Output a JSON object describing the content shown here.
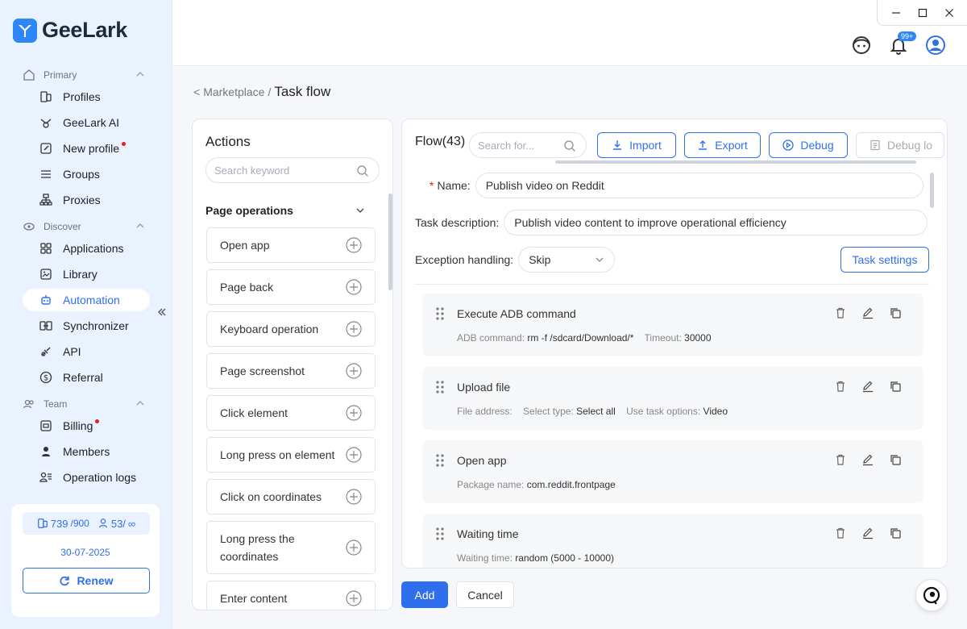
{
  "app": {
    "brand": "GeeLark",
    "accent": "#2f6fed"
  },
  "sidebar": {
    "sections": [
      {
        "label": "Primary",
        "items": [
          {
            "label": "Profiles",
            "icon": "profiles-icon"
          },
          {
            "label": "GeeLark AI",
            "icon": "ai-icon"
          },
          {
            "label": "New profile",
            "icon": "new-profile-icon",
            "dot": true
          },
          {
            "label": "Groups",
            "icon": "groups-icon"
          },
          {
            "label": "Proxies",
            "icon": "proxies-icon"
          }
        ]
      },
      {
        "label": "Discover",
        "items": [
          {
            "label": "Applications",
            "icon": "applications-icon"
          },
          {
            "label": "Library",
            "icon": "library-icon"
          },
          {
            "label": "Automation",
            "icon": "automation-icon",
            "active": true
          },
          {
            "label": "Synchronizer",
            "icon": "synchronizer-icon"
          },
          {
            "label": "API",
            "icon": "api-icon"
          },
          {
            "label": "Referral",
            "icon": "referral-icon"
          }
        ]
      },
      {
        "label": "Team",
        "items": [
          {
            "label": "Billing",
            "icon": "billing-icon",
            "dot": true
          },
          {
            "label": "Members",
            "icon": "members-icon"
          },
          {
            "label": "Operation logs",
            "icon": "operation-logs-icon"
          }
        ]
      }
    ],
    "quota": {
      "profiles_used": "739",
      "profiles_total": "/900",
      "members_used": "53/",
      "members_total": "∞",
      "date": "30-07-2025",
      "renew_label": "Renew"
    }
  },
  "topbar": {
    "notification_badge": "99+"
  },
  "breadcrumb": {
    "parent": "Marketplace",
    "separator": "/",
    "current": "Task flow",
    "back": "<"
  },
  "actions": {
    "title": "Actions",
    "search_placeholder": "Search keyword",
    "group_title": "Page operations",
    "items": [
      "Open app",
      "Page back",
      "Keyboard operation",
      "Page screenshot",
      "Click element",
      "Long press on element",
      "Click on coordinates",
      "Long press the coordinates",
      "Enter content"
    ]
  },
  "flow": {
    "title": "Flow(43)",
    "search_placeholder": "Search for...",
    "toolbar": {
      "import": "Import",
      "export": "Export",
      "debug": "Debug",
      "debug_log": "Debug lo"
    },
    "name_label": "Name:",
    "name_value": "Publish video on Reddit",
    "desc_label": "Task description:",
    "desc_value": "Publish video content to improve operational efficiency",
    "exception_label": "Exception handling:",
    "exception_value": "Skip",
    "task_settings": "Task settings",
    "steps": [
      {
        "title": "Execute ADB command",
        "desc": [
          {
            "k": "ADB command:",
            "v": "rm -f /sdcard/Download/*"
          },
          {
            "k": "Timeout:",
            "v": "30000"
          }
        ]
      },
      {
        "title": "Upload file",
        "desc": [
          {
            "k": "File address:",
            "v": ""
          },
          {
            "k": "Select type:",
            "v": "Select all"
          },
          {
            "k": "Use task options:",
            "v": "Video"
          }
        ]
      },
      {
        "title": "Open app",
        "desc": [
          {
            "k": "Package name:",
            "v": "com.reddit.frontpage"
          }
        ]
      },
      {
        "title": "Waiting time",
        "desc": [
          {
            "k": "Waiting time:",
            "v": "random (5000 - 10000)"
          }
        ]
      }
    ]
  },
  "footer": {
    "add": "Add",
    "cancel": "Cancel"
  }
}
